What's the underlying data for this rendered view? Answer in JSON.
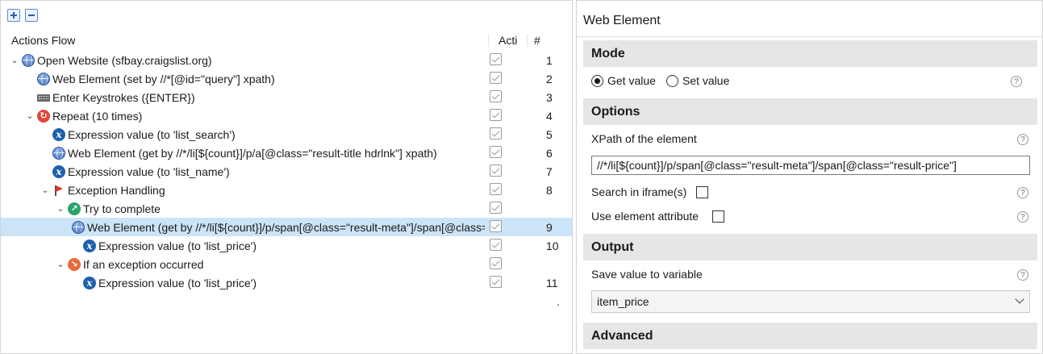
{
  "left": {
    "header": {
      "flow": "Actions Flow",
      "active": "Acti",
      "num": "#"
    },
    "rows": [
      {
        "indent": 0,
        "chevron": "⌄",
        "icon": "globe",
        "label": "Open Website (sfbay.craigslist.org)",
        "num": "1"
      },
      {
        "indent": 1,
        "chevron": "",
        "icon": "globe",
        "label": "Web Element (set by //*[@id=\"query\"] xpath)",
        "num": "2"
      },
      {
        "indent": 1,
        "chevron": "",
        "icon": "keyboard",
        "label": "Enter Keystrokes ({ENTER})",
        "num": "3"
      },
      {
        "indent": 1,
        "chevron": "⌄",
        "icon": "repeat",
        "label": "Repeat (10 times)",
        "num": "4"
      },
      {
        "indent": 2,
        "chevron": "",
        "icon": "expression",
        "label": "Expression value (to 'list_search')",
        "num": "5"
      },
      {
        "indent": 2,
        "chevron": "",
        "icon": "globe",
        "label": "Web Element (get by //*/li[${count}]/p/a[@class=\"result-title hdrlnk\"] xpath)",
        "num": "6"
      },
      {
        "indent": 2,
        "chevron": "",
        "icon": "expression",
        "label": "Expression value (to 'list_name')",
        "num": "7"
      },
      {
        "indent": 2,
        "chevron": "⌄",
        "icon": "flag",
        "label": "Exception Handling",
        "num": "8"
      },
      {
        "indent": 3,
        "chevron": "⌄",
        "icon": "try",
        "label": "Try to complete",
        "num": ""
      },
      {
        "indent": 4,
        "chevron": "",
        "icon": "globe",
        "label": "Web Element (get by //*/li[${count}]/p/span[@class=\"result-meta\"]/span[@class=\"result-price\"] xpath)",
        "num": "9",
        "selected": true
      },
      {
        "indent": 4,
        "chevron": "",
        "icon": "expression",
        "label": "Expression value (to 'list_price')",
        "num": "10"
      },
      {
        "indent": 3,
        "chevron": "⌄",
        "icon": "exception",
        "label": "If an exception occurred",
        "num": ""
      },
      {
        "indent": 4,
        "chevron": "",
        "icon": "expression",
        "label": "Expression value (to 'list_price')",
        "num": "11"
      }
    ]
  },
  "right": {
    "title": "Web Element",
    "mode": {
      "heading": "Mode",
      "get": "Get value",
      "set": "Set value",
      "selected": "get"
    },
    "options": {
      "heading": "Options",
      "xpath_label": "XPath of the element",
      "xpath_value": "//*/li[${count}]/p/span[@class=\"result-meta\"]/span[@class=\"result-price\"]",
      "iframe_label": "Search in iframe(s)",
      "attr_label": "Use element attribute"
    },
    "output": {
      "heading": "Output",
      "save_label": "Save value to variable",
      "variable": "item_price"
    },
    "advanced": {
      "heading": "Advanced"
    },
    "help_glyph": "?"
  }
}
